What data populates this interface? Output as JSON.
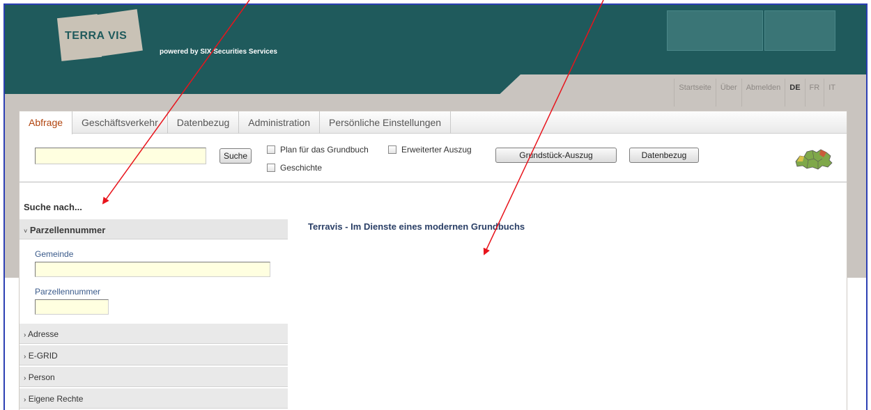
{
  "header": {
    "logo_text": "TERRA VIS",
    "tagline": "powered by SIX Securities Services"
  },
  "topnav": {
    "items": [
      {
        "label": "Startseite"
      },
      {
        "label": "Über"
      },
      {
        "label": "Abmelden"
      },
      {
        "label": "DE",
        "active": true
      },
      {
        "label": "FR"
      },
      {
        "label": "IT"
      }
    ]
  },
  "tabs": [
    {
      "label": "Abfrage",
      "active": true
    },
    {
      "label": "Geschäftsverkehr"
    },
    {
      "label": "Datenbezug"
    },
    {
      "label": "Administration"
    },
    {
      "label": "Persönliche Einstellungen"
    }
  ],
  "search": {
    "value": "",
    "button_label": "Suche"
  },
  "options": {
    "plan_label": "Plan für das Grundbuch",
    "erweitert_label": "Erweiterter Auszug",
    "geschichte_label": "Geschichte"
  },
  "actions": {
    "grundstueck_label": "Grundstück-Auszug",
    "datenbezug_label": "Datenbezug"
  },
  "sidebar": {
    "title": "Suche nach...",
    "parzelle_header": "Parzellennummer",
    "gemeinde_label": "Gemeinde",
    "parzellennummer_label": "Parzellennummer",
    "sections": [
      "Adresse",
      "E-GRID",
      "Person",
      "Eigene Rechte"
    ]
  },
  "main": {
    "heading": "Terravis - Im Dienste eines modernen Grundbuchs"
  },
  "colors": {
    "header_teal": "#1f5a5c",
    "annotation_red": "#e8141c",
    "active_tab": "#b1440e",
    "input_yellow": "#ffffe0"
  },
  "icons": {
    "map": "switzerland-map-icon",
    "chevron_open": "chevron-down-icon",
    "chevron_closed": "chevron-right-icon"
  }
}
